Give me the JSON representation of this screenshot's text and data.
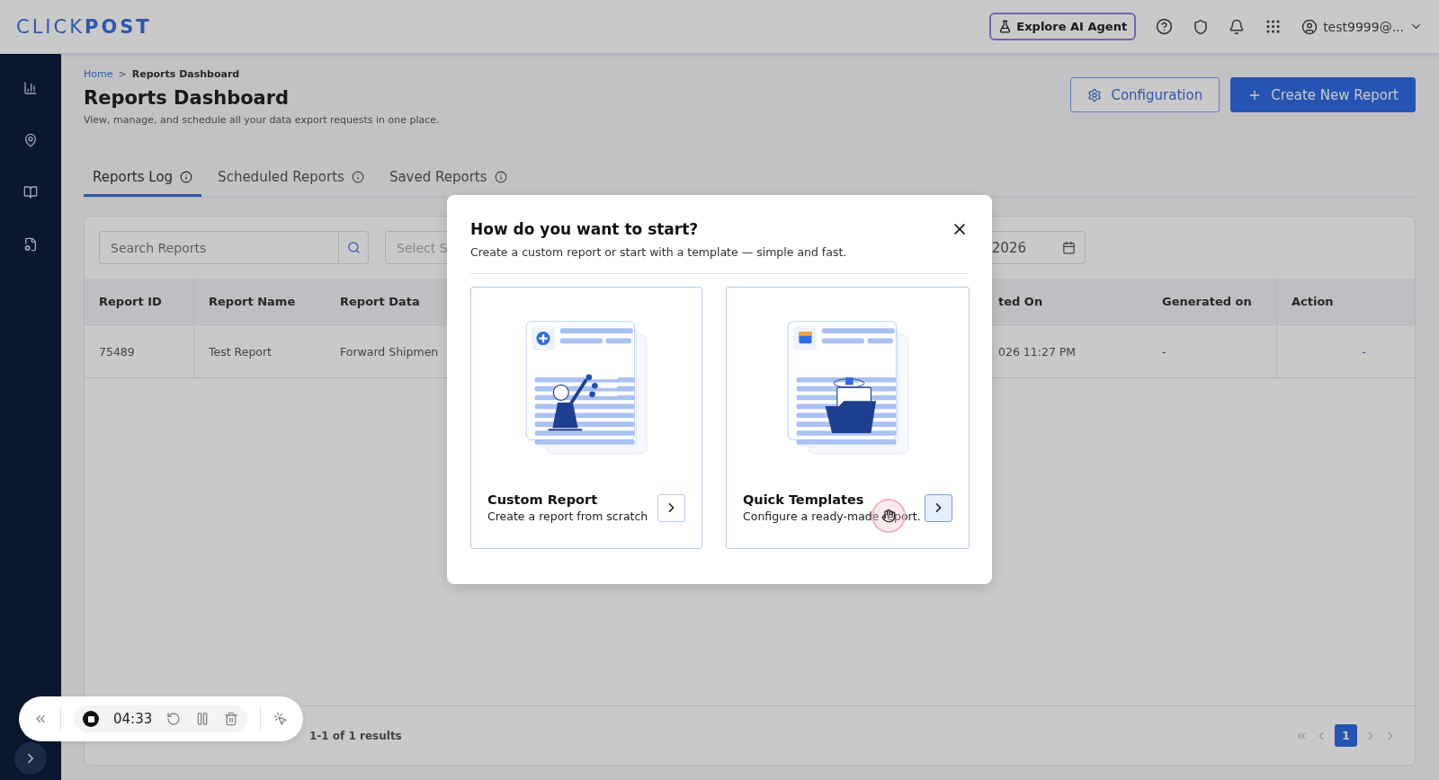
{
  "header": {
    "logo": "CLICK**POST**",
    "ai_button": "Explore AI Agent",
    "user": "test9999@..."
  },
  "breadcrumb": {
    "home": "Home",
    "separator": ">",
    "current": "Reports Dashboard"
  },
  "page": {
    "title": "Reports Dashboard",
    "subtitle": "View, manage, and schedule all your data export requests in one place."
  },
  "actions": [
    {
      "kind": "outline",
      "label": "Configuration"
    },
    {
      "kind": "primary",
      "label": "Create New Report"
    }
  ],
  "tabs": [
    {
      "label": "Reports Log",
      "selected": true
    },
    {
      "label": "Scheduled Reports",
      "selected": false
    },
    {
      "label": "Saved Reports",
      "selected": false
    }
  ],
  "filters": {
    "search_placeholder": "Search Reports",
    "select_placeholder": "Select S",
    "date_value": "2026"
  },
  "table": {
    "columns": [
      "Report ID",
      "Report Name",
      "Report Data",
      "ted On",
      "Generated on",
      "Action"
    ],
    "rows": [
      [
        "75489",
        "Test Report",
        "Forward Shipmen",
        "026 11:27 PM",
        "-",
        "-"
      ]
    ]
  },
  "footer": {
    "results": "1-1 of 1 results",
    "pages": [
      {
        "label": "1",
        "selected": true
      }
    ]
  },
  "modal": {
    "title": "How do you want to start?",
    "subtitle": "Create a custom report or start with a template — simple and fast.",
    "options": [
      {
        "kind": "custom",
        "title": "Custom Report",
        "description": "Create a report from scratch",
        "hovered": false
      },
      {
        "kind": "templates",
        "title": "Quick Templates",
        "description": "Configure a ready-made report.",
        "hovered": true
      }
    ]
  },
  "recorder": {
    "time": "04:33"
  }
}
